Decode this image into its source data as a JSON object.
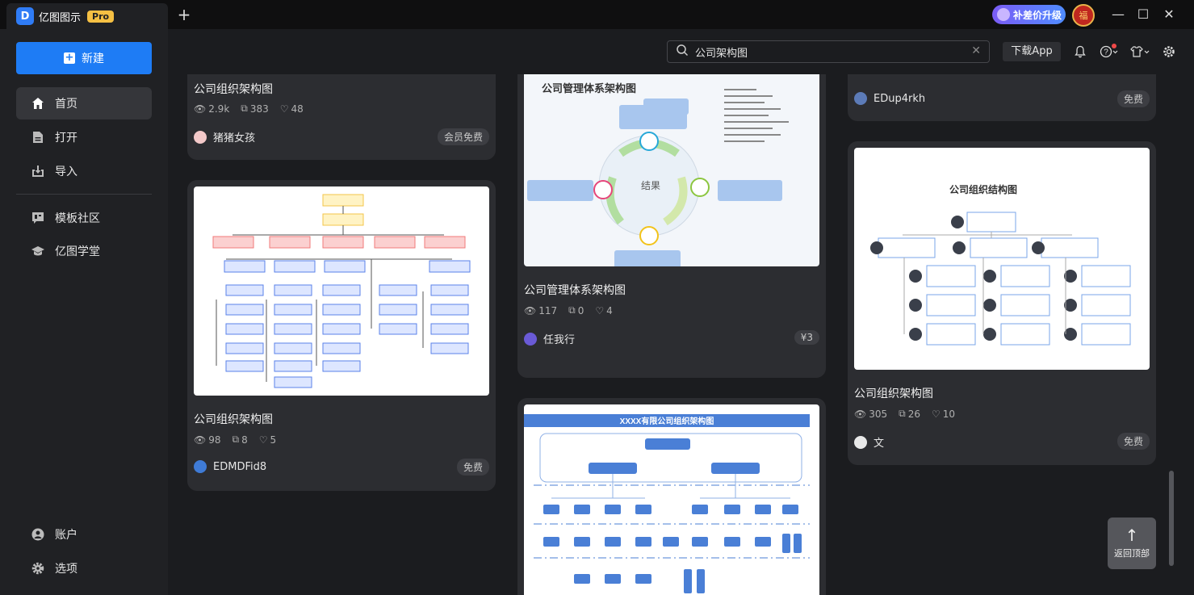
{
  "app": {
    "name": "亿图图示",
    "badge": "Pro",
    "logo": "D",
    "new_tab": "+"
  },
  "titlebar": {
    "upgrade_label": "补差价升级",
    "avatar_text": "福",
    "minimize": "—",
    "maximize": "☐",
    "close": "✕"
  },
  "sidebar": {
    "new_label": "新建",
    "items": [
      {
        "label": "首页",
        "icon": "home-icon"
      },
      {
        "label": "打开",
        "icon": "file-icon"
      },
      {
        "label": "导入",
        "icon": "import-icon"
      },
      {
        "label": "模板社区",
        "icon": "community-icon"
      },
      {
        "label": "亿图学堂",
        "icon": "graduation-cap-icon"
      },
      {
        "label": "账户",
        "icon": "account-icon"
      },
      {
        "label": "选项",
        "icon": "gear-icon"
      }
    ]
  },
  "topbar": {
    "search_value": "公司架构图",
    "download_label": "下载App"
  },
  "cards": [
    {
      "title": "公司组织架构图",
      "views": "2.9k",
      "copies": "383",
      "likes": "48",
      "author": "猪猪女孩",
      "tag": "会员免费"
    },
    {
      "title": "公司组织架构图",
      "views": "98",
      "copies": "8",
      "likes": "5",
      "author": "EDMDFid8",
      "tag": "免费"
    },
    {
      "title": "公司管理体系架构图",
      "views": "117",
      "copies": "0",
      "likes": "4",
      "author": "任我行",
      "tag": "¥3"
    },
    {
      "title": "",
      "author": "EDup4rkh",
      "tag": "免费"
    },
    {
      "title": "公司组织架构图",
      "views": "305",
      "copies": "26",
      "likes": "10",
      "author": "文",
      "tag": "免费"
    }
  ],
  "thumb_texts": {
    "mgmt_title": "公司管理体系架构图",
    "mgmt_center": "结果",
    "org_title": "公司组织结构图",
    "xxxx_title": "XXXX有限公司组织架构图"
  },
  "back_top_label": "返回顶部"
}
